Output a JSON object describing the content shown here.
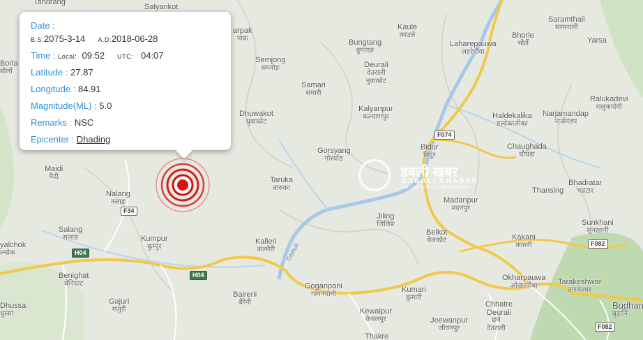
{
  "popup": {
    "date_label": "Date :",
    "bs_prefix": "B.S:",
    "bs_date": "2075-3-14",
    "ad_prefix": "A.D:",
    "ad_date": "2018-06-28",
    "time_label": "Time :",
    "local_prefix": "Local:",
    "local_time": "09:52",
    "utc_prefix": "UTC:",
    "utc_time": "04:07",
    "latitude_label": "Latitude :",
    "latitude": "27.87",
    "longitude_label": "Longitude :",
    "longitude": "84.91",
    "magnitude_label": "Magnitude(ML) :",
    "magnitude": "5.0",
    "remarks_label": "Remarks :",
    "remarks": "NSC",
    "epicenter_label": "Epicenter :",
    "epicenter": "Dhading"
  },
  "watermark": {
    "title": "डबली खबर",
    "subtitle": "DABALI KHABAR",
    "tagline": "ONLINE DIGITAL NEWSPAPER"
  },
  "places": {
    "tandrang": "Tandrang",
    "salyankot": "Salyankot",
    "arpak": "arpak",
    "arpak_np": "पाक",
    "kaule": "Kaule",
    "kaule_np": "काउले",
    "laharepauwa": "Laharepauwa",
    "laharepauwa_np": "लहरेपौवा",
    "bhorle": "Bhorle",
    "bhorle_np": "भोर्ले",
    "saramthali": "Saramthali",
    "saramthali_np": "सरमथली",
    "yarsa": "Yarsa",
    "borla": "Borla",
    "borla_np": "बोर्ला",
    "bungtang": "Bungtang",
    "bungtang_np": "बुगताङ",
    "semjong": "Semjong",
    "semjong_np": "सम्जोङ",
    "deurali1": "Deurali",
    "deurali1_np": "देउराली",
    "nuwakot": "नुवाकोट",
    "samari": "Samari",
    "samari_np": "समारी",
    "ralukadevi": "Ralukadevi",
    "ralukadevi_np": "रालुकादेवी",
    "dhuwakot": "Dhuwakot",
    "dhuwakot_np": "धुवाकोट",
    "kalyanpur": "Kalyanpur",
    "kalyanpur_np": "कल्याणपुर",
    "haldekalika": "Haldekalika",
    "haldekalika_np": "हल्देकालीका",
    "narjamandap": "Narjamandap",
    "narjamandap_np": "नार्जमंडप",
    "bidur": "Bidur",
    "bidur_np": "बिदुर",
    "chaughada": "Chaughada",
    "chaughada_np": "चौघडा",
    "gorsyang": "Gorsyang",
    "gorsyang_np": "गोर्स्याङ",
    "maidi": "Maidi",
    "maidi_np": "मैदी",
    "taruka": "Taruka",
    "taruka_np": "तारुका",
    "thansing": "Thansing",
    "bhadratar": "Bhadratar",
    "bhadratar_np": "भद्रटार",
    "nalang": "Nalang",
    "nalang_np": "नलाङ",
    "madanpur": "Madanpur",
    "madanpur_np": "मदनपुर",
    "jiling": "Jiling",
    "jiling_np": "जिलिङ",
    "sunkhani": "Sunkhani",
    "sunkhani_np": "सुनखानी",
    "salang": "Salang",
    "salang_np": "सलाङ",
    "kumpur": "Kumpur",
    "kumpur_np": "कुम्पुर",
    "kalleri": "Kalleri",
    "kalleri_np": "कल्लेरी",
    "belkot": "Belkot",
    "belkot_np": "बेलकोट",
    "kakani": "Kakani",
    "kakani_np": "ककनी",
    "yalchok": "yalchok",
    "yalchok_np": "ल्चोक",
    "benighat": "Benighat",
    "benighat_np": "बेनिघाट",
    "okharpauwa": "Okharpauwa",
    "okharpauwa_np": "ओखरपौवा",
    "tarakeshwar": "Tarakeshwar",
    "tarakeshwar_np": "तारकेश्वर",
    "goganpani": "Goganpani",
    "goganpani_np": "गागनपानी",
    "kumari": "Kumari",
    "kumari_np": "कुमारी",
    "baireni": "Baireni",
    "baireni_np": "बैरेनी",
    "dhussa": "Dhussa",
    "dhussa_np": "धुस्सा",
    "gajuri": "Gajuri",
    "gajuri_np": "गजुरी",
    "kewalpur": "Kewalpur",
    "kewalpur_np": "केवलपुर",
    "chhatre_deurali": "Chhatre",
    "chhatre_deurali_2": "Deurali",
    "chhatre_np": "छत्रे",
    "chhatre_deurali_np": "देउराली",
    "jeewanpur": "Jeewanpur",
    "jeewanpur_np": "जीवनपुर",
    "budhanilkantha": "Budhan",
    "budhanilkantha_np": "बुढानि",
    "thakre": "Thakre"
  },
  "roads": {
    "f074": "F074",
    "f34": "F34",
    "h04_a": "H04",
    "h04_b": "H04",
    "f082_a": "F082",
    "f082_b": "F082"
  },
  "river": {
    "trishuli": "Trishuli"
  }
}
